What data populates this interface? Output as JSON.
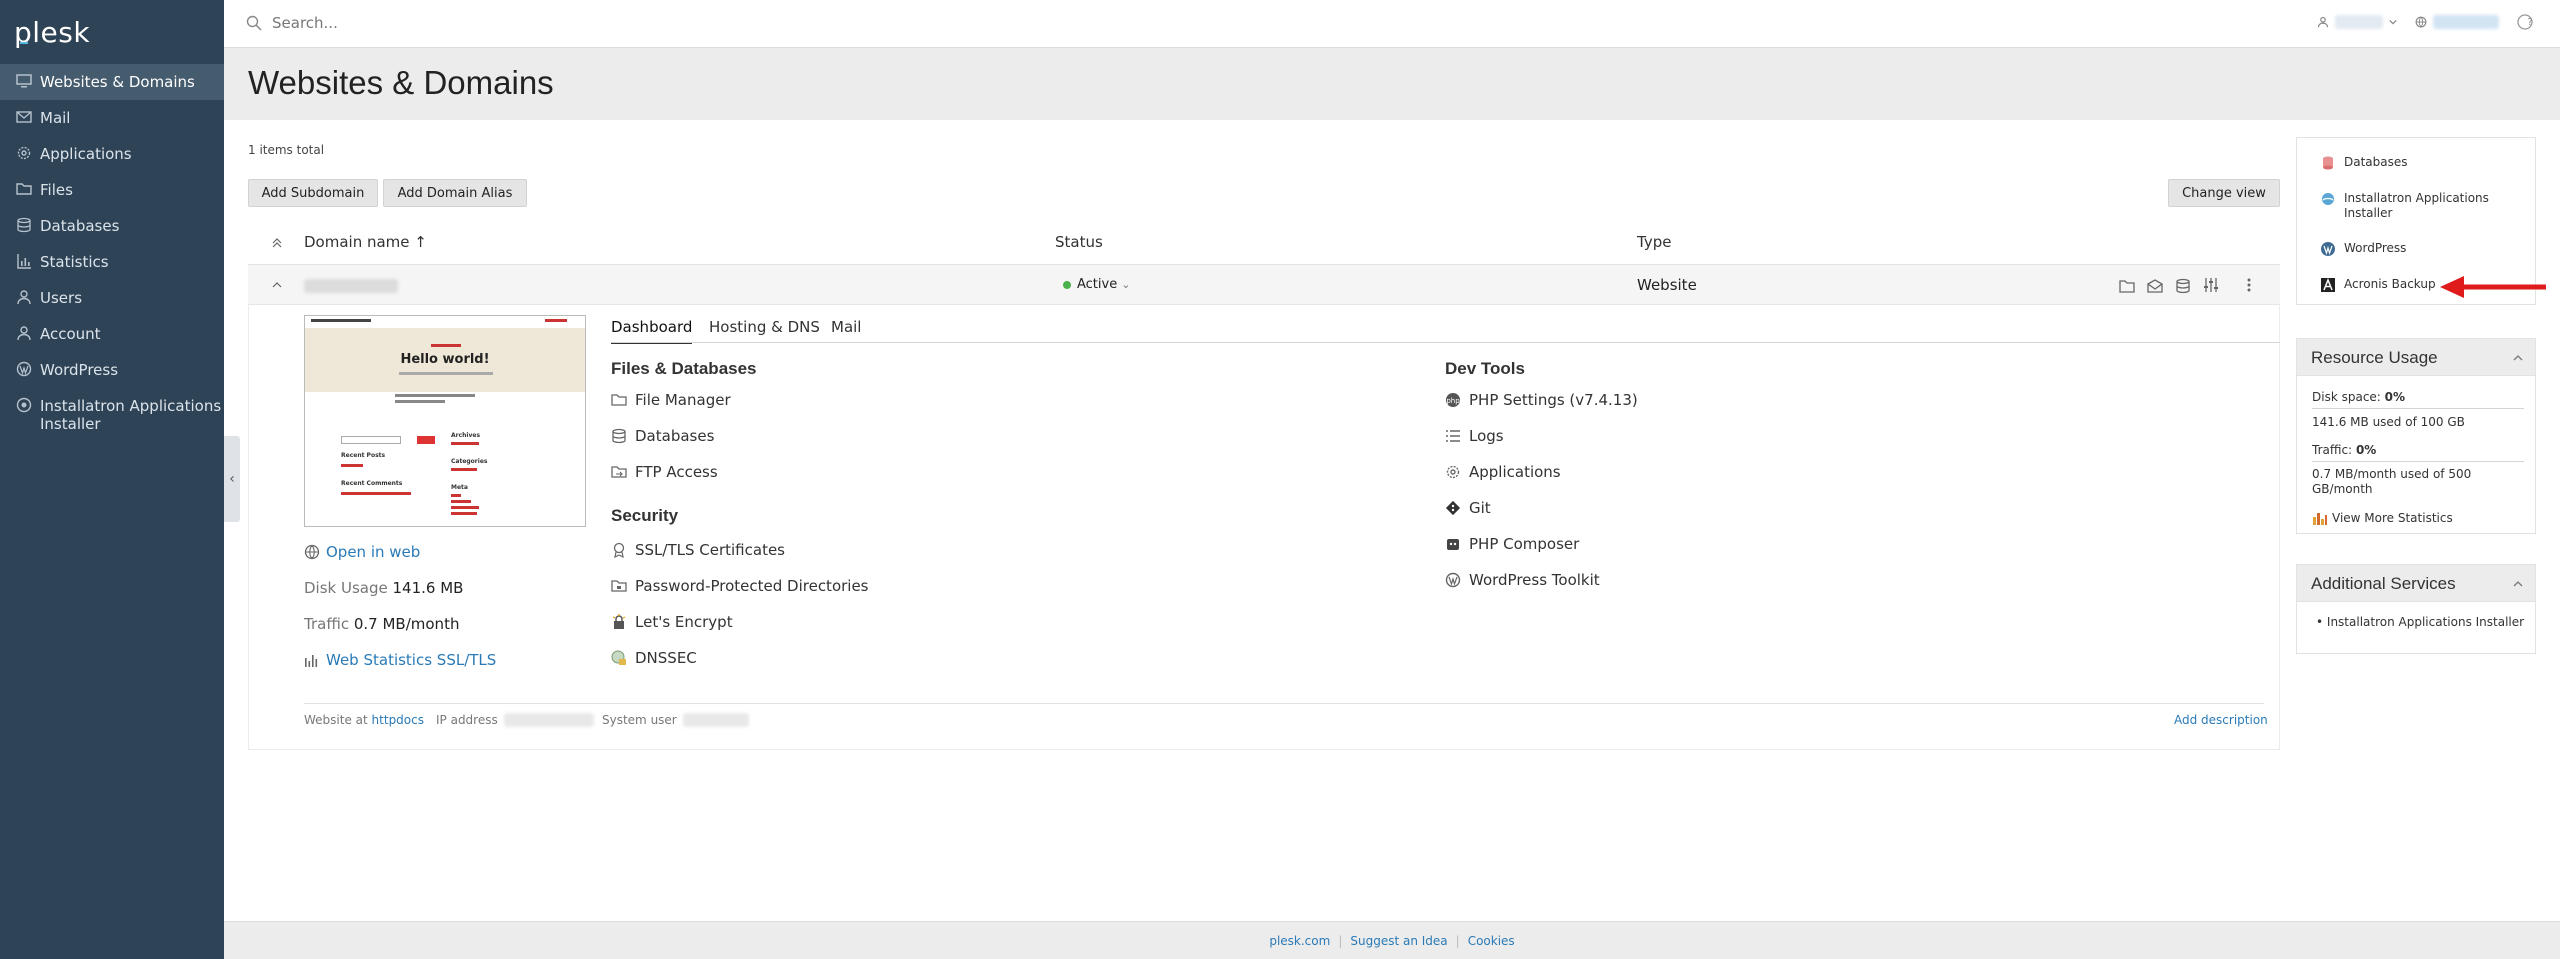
{
  "app": {
    "logo": "plesk"
  },
  "sidebar": {
    "items": [
      {
        "label": "Websites & Domains",
        "icon": "monitor-icon",
        "active": true
      },
      {
        "label": "Mail",
        "icon": "mail-icon"
      },
      {
        "label": "Applications",
        "icon": "gear-icon"
      },
      {
        "label": "Files",
        "icon": "folder-icon"
      },
      {
        "label": "Databases",
        "icon": "database-icon"
      },
      {
        "label": "Statistics",
        "icon": "bar-chart-icon"
      },
      {
        "label": "Users",
        "icon": "user-icon"
      },
      {
        "label": "Account",
        "icon": "user-icon"
      },
      {
        "label": "WordPress",
        "icon": "wordpress-icon"
      },
      {
        "label": "Installatron Applications Installer",
        "icon": "installatron-icon"
      }
    ],
    "collapse_glyph": "‹"
  },
  "topbar": {
    "search_placeholder": "Search...",
    "help_glyph": "?"
  },
  "page": {
    "title": "Websites & Domains",
    "items_total": "1 items total",
    "add_subdomain": "Add Subdomain",
    "add_domain_alias": "Add Domain Alias",
    "change_view": "Change view"
  },
  "table": {
    "col_domain": "Domain name ↑",
    "col_status": "Status",
    "col_type": "Type",
    "row": {
      "status": "Active",
      "status_caret": "⌄",
      "type": "Website"
    }
  },
  "preview": {
    "hello": "Hello world!",
    "recent_posts": "Recent Posts",
    "recent_comments": "Recent Comments",
    "archives": "Archives",
    "categories": "Categories",
    "meta": "Meta"
  },
  "site_info": {
    "open_in_web": "Open in web",
    "disk_label": "Disk Usage",
    "disk_value": "141.6 MB",
    "traffic_label": "Traffic",
    "traffic_value": "0.7 MB/month",
    "web_stats": "Web Statistics SSL/TLS"
  },
  "tabs": [
    "Dashboard",
    "Hosting & DNS",
    "Mail"
  ],
  "files_databases": {
    "heading": "Files & Databases",
    "items": [
      "File Manager",
      "Databases",
      "FTP Access"
    ]
  },
  "security": {
    "heading": "Security",
    "items": [
      "SSL/TLS Certificates",
      "Password-Protected Directories",
      "Let's Encrypt",
      "DNSSEC"
    ]
  },
  "dev_tools": {
    "heading": "Dev Tools",
    "items": [
      "PHP Settings (v7.4.13)",
      "Logs",
      "Applications",
      "Git",
      "PHP Composer",
      "WordPress Toolkit"
    ]
  },
  "footer_info": {
    "website_at": "Website at",
    "httpdocs": "httpdocs",
    "ip_address": "IP address",
    "system_user": "System user",
    "add_description": "Add description"
  },
  "right_panel": {
    "quick": [
      "Databases",
      "Installatron Applications Installer",
      "WordPress",
      "Acronis Backup"
    ],
    "resource_usage": {
      "title": "Resource Usage",
      "disk_label": "Disk space:",
      "disk_pct": "0%",
      "disk_detail": "141.6 MB used of 100 GB",
      "traffic_label": "Traffic:",
      "traffic_pct": "0%",
      "traffic_detail": "0.7 MB/month used of 500 GB/month",
      "more": "View More Statistics"
    },
    "additional_services": {
      "title": "Additional Services",
      "item": "Installatron Applications Installer"
    }
  },
  "footer": {
    "links": [
      "plesk.com",
      "Suggest an Idea",
      "Cookies"
    ]
  },
  "colors": {
    "sidebar": "#2f4356",
    "link": "#2a7ab7",
    "accent_arrow": "#e01b1b",
    "status_active": "#4bb24b"
  }
}
